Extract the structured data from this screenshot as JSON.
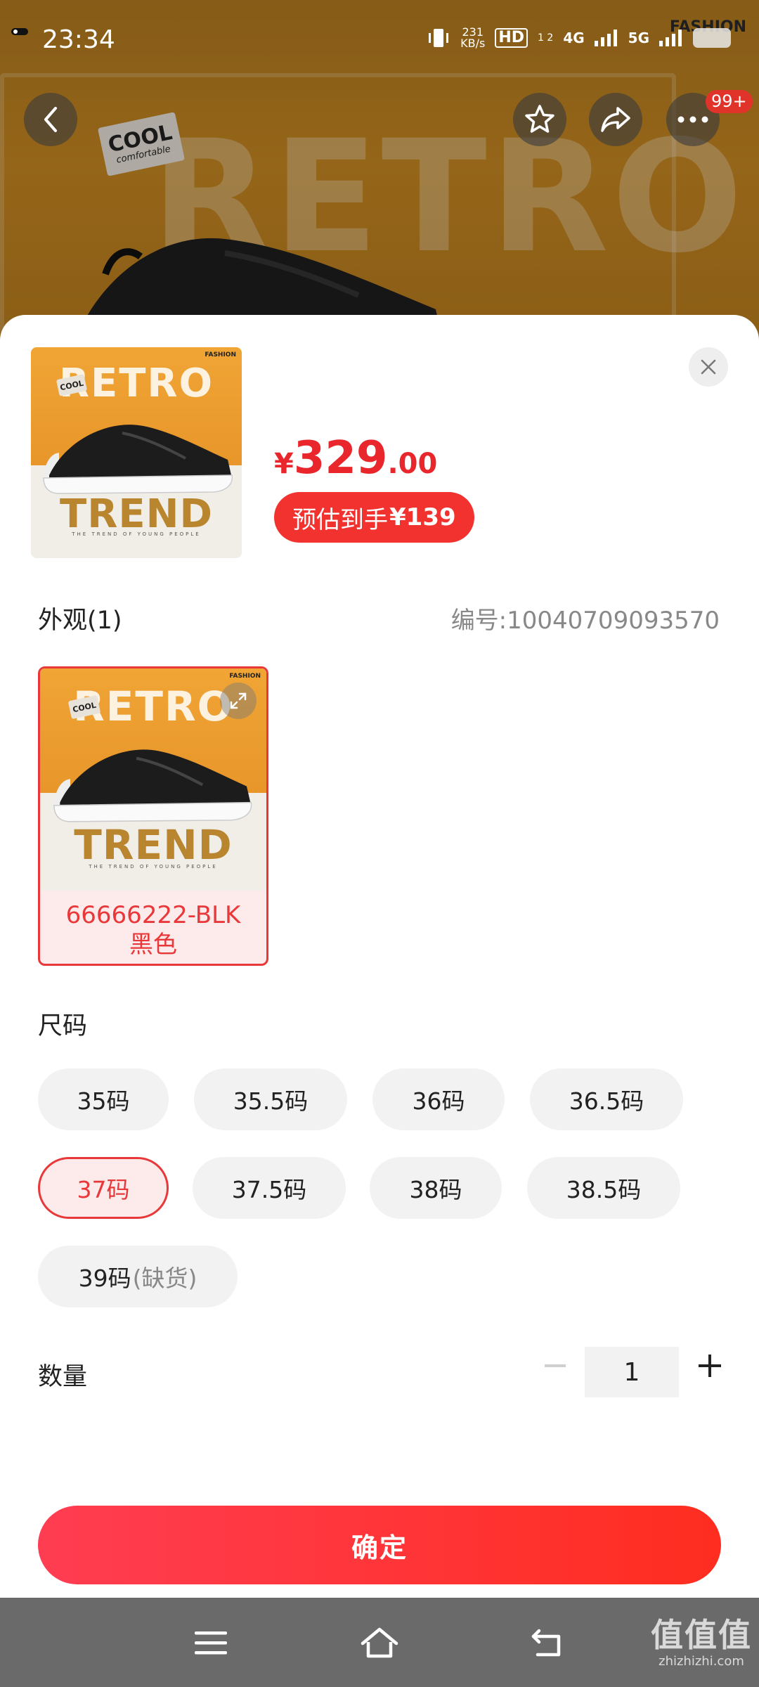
{
  "status_bar": {
    "time": "23:34",
    "net_speed": "231",
    "net_unit": "KB/s",
    "hd": "HD",
    "sim": "1 2",
    "net1": "4G",
    "net2": "5G",
    "icons": [
      "vibrate-icon",
      "signal-icon",
      "battery-icon"
    ]
  },
  "hero": {
    "watermark_text": "RETRO",
    "tag_line1": "COOL",
    "tag_line2": "comfortable",
    "brand": "FASHION",
    "more_badge": "99+"
  },
  "sheet": {
    "price_currency": "¥",
    "price_int": "329",
    "price_dec": ".00",
    "estimate_label": "预估到手",
    "estimate_value": "¥139",
    "appearance_label": "外观(1)",
    "code_label": "编号:10040709093570",
    "variant": {
      "code": "66666222-BLK",
      "color": "黑色"
    },
    "poster": {
      "retro": "RETRO",
      "trend": "TREND",
      "young": "THE TREND OF YOUNG PEOPLE",
      "fashion": "FASHION",
      "cool": "COOL"
    },
    "size_label": "尺码",
    "sizes": [
      {
        "label": "35码",
        "suffix": ""
      },
      {
        "label": "35.5码",
        "suffix": ""
      },
      {
        "label": "36码",
        "suffix": ""
      },
      {
        "label": "36.5码",
        "suffix": ""
      },
      {
        "label": "37码",
        "suffix": ""
      },
      {
        "label": "37.5码",
        "suffix": ""
      },
      {
        "label": "38码",
        "suffix": ""
      },
      {
        "label": "38.5码",
        "suffix": ""
      },
      {
        "label": "39码",
        "suffix": "(缺货)"
      }
    ],
    "selected_size": "37码",
    "quantity_label": "数量",
    "quantity_value": "1",
    "confirm_label": "确定"
  },
  "watermark": {
    "line1": "值值值",
    "line2": "zhizhizhi.com"
  },
  "colors": {
    "accent": "#e8383a",
    "price": "#e8262b",
    "confirm_start": "#ff3d52",
    "confirm_end": "#ff2d20"
  }
}
